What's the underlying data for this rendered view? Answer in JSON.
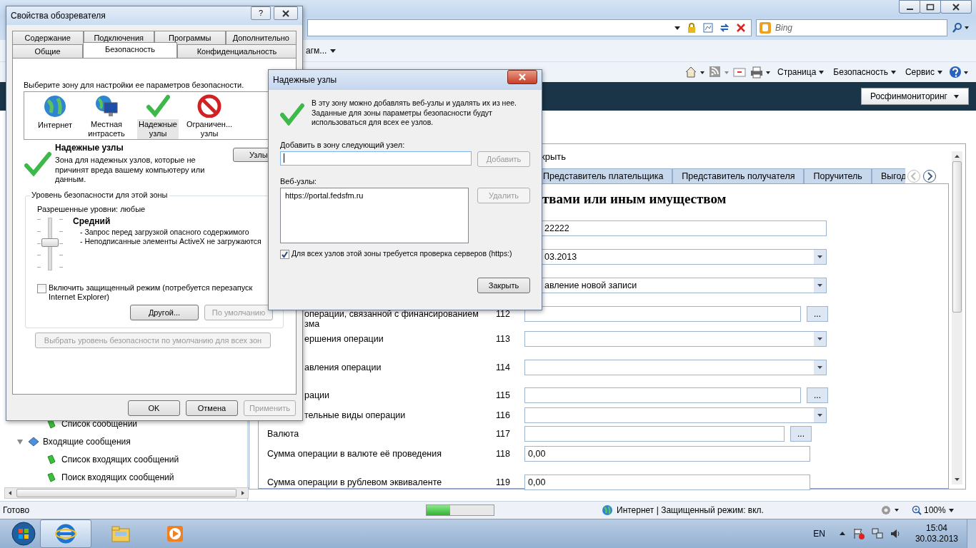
{
  "browser": {
    "toolbar": {
      "favorites_item": "агм...",
      "search": {
        "placeholder": "Bing"
      }
    },
    "command_bar": [
      "Страница",
      "Безопасность",
      "Сервис"
    ],
    "header": {
      "menu": "Росфинмониторинг"
    },
    "tree": [
      {
        "label": "Список сообщений"
      },
      {
        "label": "Входящие сообщения",
        "expanded": true,
        "children": [
          {
            "label": "Список входящих сообщений"
          },
          {
            "label": "Поиск входящих сообщений"
          }
        ]
      }
    ],
    "form": {
      "close_link": "крыть",
      "tabs": [
        {
          "label": "Представитель плательщика",
          "selected": false
        },
        {
          "label": "Представитель получателя",
          "selected": false
        },
        {
          "label": "Поручитель",
          "selected": false
        },
        {
          "label": "Выгод",
          "selected": false
        }
      ],
      "heading": "твами или иным имуществом",
      "rows": [
        {
          "kind": "text",
          "clipped": true,
          "value": "22222"
        },
        {
          "kind": "select",
          "clipped": true,
          "value": "03.2013"
        },
        {
          "kind": "select",
          "clipped": true,
          "value": "авление новой записи"
        },
        {
          "kind": "lookup",
          "clipped": true,
          "label": "операции, связанной с финансированием\nзма",
          "number": "112",
          "button": "..."
        },
        {
          "kind": "select",
          "clipped": true,
          "label": "ершения операции",
          "number": "113"
        },
        {
          "kind": "select",
          "clipped": true,
          "label": "авления операции",
          "number": "114"
        },
        {
          "kind": "lookup",
          "clipped": true,
          "label": "рации",
          "number": "115",
          "button": "..."
        },
        {
          "kind": "select",
          "clipped": true,
          "label": "тельные виды операции",
          "number": "116"
        },
        {
          "kind": "lookup",
          "clipped": false,
          "label": "Валюта",
          "number": "117",
          "button": "..."
        },
        {
          "kind": "text",
          "clipped": false,
          "label": "Сумма операции в валюте её проведения",
          "number": "118",
          "value": "0,00"
        },
        {
          "kind": "text",
          "clipped": false,
          "label": "Сумма операции в рублевом эквиваленте",
          "number": "119",
          "value": "0,00"
        }
      ]
    },
    "status_bar": {
      "text": "Готово",
      "progress": {
        "level": 0.35
      },
      "zone": "Интернет | Защищенный режим: вкл.",
      "zoom": "100%"
    }
  },
  "internet_options": {
    "title": "Свойства обозревателя",
    "help_button": "?",
    "tabs_row1": [
      {
        "label": "Содержание",
        "selected": false
      },
      {
        "label": "Подключения",
        "selected": false
      },
      {
        "label": "Программы",
        "selected": false
      },
      {
        "label": "Дополнительно",
        "selected": false
      }
    ],
    "tabs_row2": [
      {
        "label": "Общие",
        "selected": false
      },
      {
        "label": "Безопасность",
        "selected": true
      },
      {
        "label": "Конфиденциальность",
        "selected": false
      }
    ],
    "zone_prompt": "Выберите зону для настройки ее параметров безопасности.",
    "zones": [
      {
        "kind": "internet",
        "label": "Интернет",
        "selected": false
      },
      {
        "kind": "intranet",
        "label": "Местная\nинтрасеть",
        "selected": false
      },
      {
        "kind": "trusted",
        "label": "Надежные\nузлы",
        "selected": true
      },
      {
        "kind": "restricted",
        "label": "Ограничен...\nузлы",
        "selected": false
      }
    ],
    "zone_title": "Надежные узлы",
    "zone_description": "Зона для надежных узлов, которые не\nпричинят вреда вашему компьютеру или\nданным.",
    "sites_button": "Узлы",
    "level_group": {
      "title": "Уровень безопасности для этой зоны",
      "allowed": "Разрешенные уровни: любые",
      "slider": {
        "level": 0.5
      },
      "level_name": "Средний",
      "details": [
        "- Запрос перед загрузкой опасного содержимого",
        "- Неподписанные элементы ActiveX не загружаются"
      ],
      "protected_mode": {
        "label": "Включить защищенный режим (потребуется перезапуск\nInternet Explorer)",
        "checked": false
      },
      "buttons": [
        {
          "label": "Другой...",
          "disabled": false
        },
        {
          "label": "По умолчанию",
          "disabled": true
        }
      ]
    },
    "reset_all": {
      "label": "Выбрать уровень безопасности по умолчанию для всех зон",
      "disabled": true
    },
    "buttons": [
      {
        "label": "OK",
        "disabled": false
      },
      {
        "label": "Отмена",
        "disabled": false
      },
      {
        "label": "Применить",
        "disabled": true
      }
    ]
  },
  "trusted_sites": {
    "title": "Надежные узлы",
    "description": "В эту зону можно добавлять веб-узлы и удалять их из нее.\nЗаданные для зоны параметры безопасности будут\nиспользоваться для всех ее узлов.",
    "add_label": "Добавить в зону следующий узел:",
    "add_button": {
      "label": "Добавить",
      "disabled": true
    },
    "list_label": "Веб-узлы:",
    "sites": [
      "https://portal.fedsfm.ru"
    ],
    "remove_button": {
      "label": "Удалить",
      "disabled": true
    },
    "require_https": {
      "label": "Для всех узлов этой зоны требуется проверка серверов (https:)",
      "checked": true
    },
    "close_button": "Закрыть"
  },
  "taskbar": {
    "language": "EN",
    "time": "15:04",
    "date": "30.03.2013"
  }
}
